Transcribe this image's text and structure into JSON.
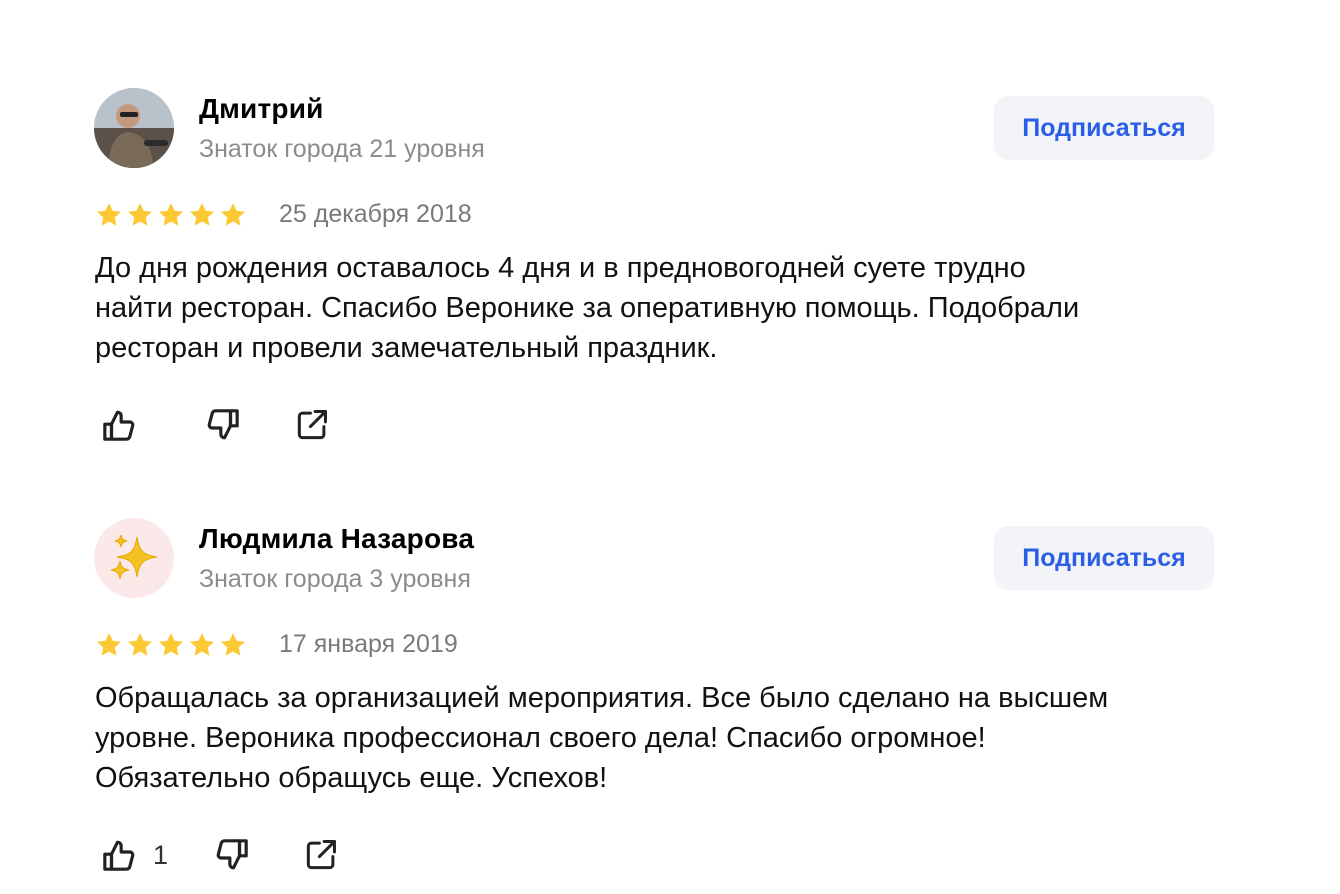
{
  "reviews": [
    {
      "author": "Дмитрий",
      "level": "Знаток города 21 уровня",
      "subscribe_label": "Подписаться",
      "rating": 5,
      "date": "25 декабря 2018",
      "text_lines": [
        "До дня рождения оставалось 4 дня и в предновогодней суете трудно",
        "найти ресторан. Спасибо Веронике за оперативную помощь. Подобрали",
        "ресторан и провели замечательный праздник."
      ],
      "like_count": ""
    },
    {
      "author": "Людмила Назарова",
      "level": "Знаток города 3 уровня",
      "subscribe_label": "Подписаться",
      "rating": 5,
      "date": "17 января 2019",
      "text_lines": [
        "Обращалась за организацией мероприятия. Все было сделано на высшем",
        "уровне. Вероника профессионал своего дела! Спасибо огромное!",
        "Обязательно обращусь еще. Успехов!"
      ],
      "like_count": "1"
    }
  ],
  "colors": {
    "star": "#fcc934",
    "link": "#2a5ee6",
    "button_bg": "#f2f4f8",
    "muted": "#8c8c8c"
  },
  "icons": [
    "thumbs-up-icon",
    "thumbs-down-icon",
    "share-icon",
    "star-icon",
    "sparkles-icon"
  ]
}
